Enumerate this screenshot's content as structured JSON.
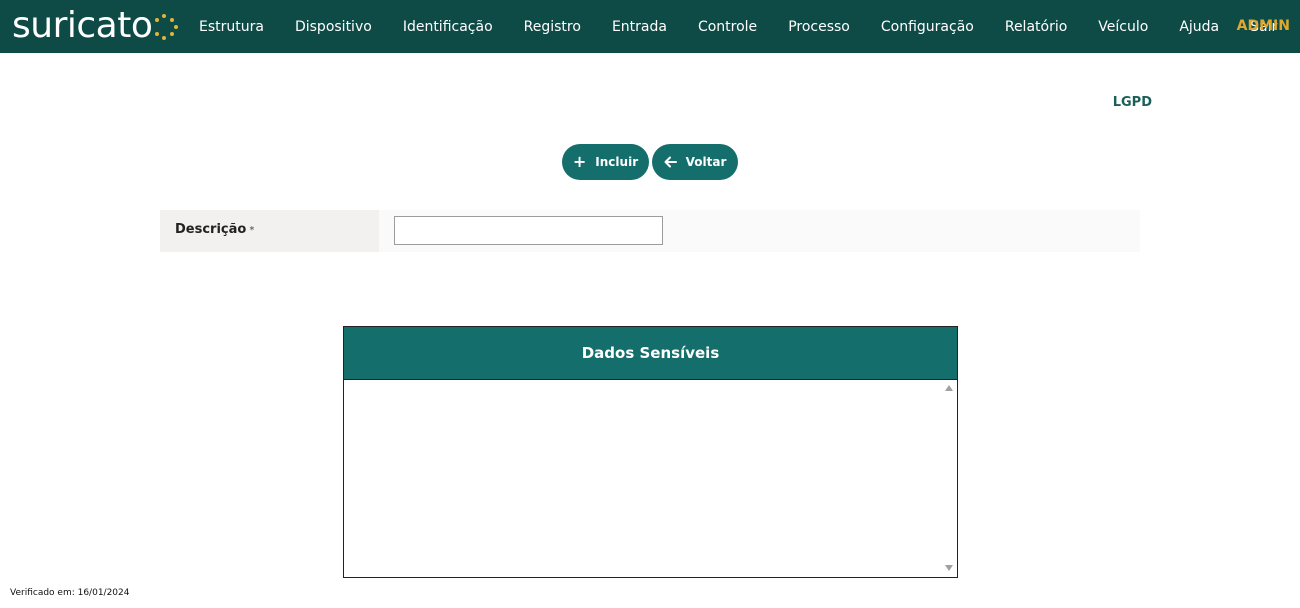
{
  "header": {
    "logo_text": "suricato",
    "nav": [
      {
        "label": "Estrutura"
      },
      {
        "label": "Dispositivo"
      },
      {
        "label": "Identificação"
      },
      {
        "label": "Registro"
      },
      {
        "label": "Entrada"
      },
      {
        "label": "Controle"
      },
      {
        "label": "Processo"
      },
      {
        "label": "Configuração"
      },
      {
        "label": "Relatório"
      },
      {
        "label": "Veículo"
      },
      {
        "label": "Ajuda"
      },
      {
        "label": "Sair"
      }
    ],
    "user": "ADMIN"
  },
  "page": {
    "title": "LGPD"
  },
  "actions": {
    "incluir_label": "Incluir",
    "voltar_label": "Voltar",
    "incluir_icon": "plus-icon",
    "voltar_icon": "arrow-left-icon"
  },
  "form": {
    "descricao_label": "Descrição",
    "required_marker": "*",
    "descricao_value": ""
  },
  "panel": {
    "title": "Dados Sensíveis"
  },
  "footer": {
    "verified_text": "Verificado em: 16/01/2024"
  },
  "colors": {
    "header_bg": "#0e4b47",
    "primary": "#146f6c",
    "admin": "#e0a82e",
    "logo_dots": "#e0b43a"
  }
}
